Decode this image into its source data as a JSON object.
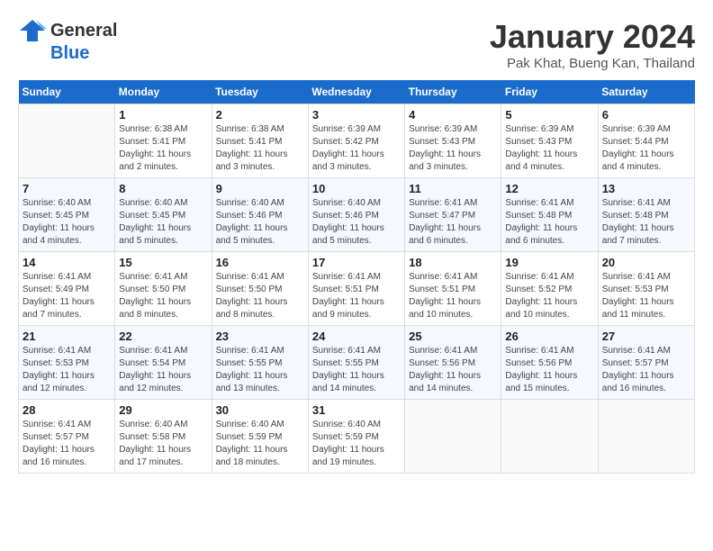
{
  "header": {
    "logo_line1": "General",
    "logo_line2": "Blue",
    "month_title": "January 2024",
    "subtitle": "Pak Khat, Bueng Kan, Thailand"
  },
  "days_of_week": [
    "Sunday",
    "Monday",
    "Tuesday",
    "Wednesday",
    "Thursday",
    "Friday",
    "Saturday"
  ],
  "weeks": [
    [
      {
        "day": "",
        "info": ""
      },
      {
        "day": "1",
        "info": "Sunrise: 6:38 AM\nSunset: 5:41 PM\nDaylight: 11 hours\nand 2 minutes."
      },
      {
        "day": "2",
        "info": "Sunrise: 6:38 AM\nSunset: 5:41 PM\nDaylight: 11 hours\nand 3 minutes."
      },
      {
        "day": "3",
        "info": "Sunrise: 6:39 AM\nSunset: 5:42 PM\nDaylight: 11 hours\nand 3 minutes."
      },
      {
        "day": "4",
        "info": "Sunrise: 6:39 AM\nSunset: 5:43 PM\nDaylight: 11 hours\nand 3 minutes."
      },
      {
        "day": "5",
        "info": "Sunrise: 6:39 AM\nSunset: 5:43 PM\nDaylight: 11 hours\nand 4 minutes."
      },
      {
        "day": "6",
        "info": "Sunrise: 6:39 AM\nSunset: 5:44 PM\nDaylight: 11 hours\nand 4 minutes."
      }
    ],
    [
      {
        "day": "7",
        "info": "Sunrise: 6:40 AM\nSunset: 5:45 PM\nDaylight: 11 hours\nand 4 minutes."
      },
      {
        "day": "8",
        "info": "Sunrise: 6:40 AM\nSunset: 5:45 PM\nDaylight: 11 hours\nand 5 minutes."
      },
      {
        "day": "9",
        "info": "Sunrise: 6:40 AM\nSunset: 5:46 PM\nDaylight: 11 hours\nand 5 minutes."
      },
      {
        "day": "10",
        "info": "Sunrise: 6:40 AM\nSunset: 5:46 PM\nDaylight: 11 hours\nand 5 minutes."
      },
      {
        "day": "11",
        "info": "Sunrise: 6:41 AM\nSunset: 5:47 PM\nDaylight: 11 hours\nand 6 minutes."
      },
      {
        "day": "12",
        "info": "Sunrise: 6:41 AM\nSunset: 5:48 PM\nDaylight: 11 hours\nand 6 minutes."
      },
      {
        "day": "13",
        "info": "Sunrise: 6:41 AM\nSunset: 5:48 PM\nDaylight: 11 hours\nand 7 minutes."
      }
    ],
    [
      {
        "day": "14",
        "info": "Sunrise: 6:41 AM\nSunset: 5:49 PM\nDaylight: 11 hours\nand 7 minutes."
      },
      {
        "day": "15",
        "info": "Sunrise: 6:41 AM\nSunset: 5:50 PM\nDaylight: 11 hours\nand 8 minutes."
      },
      {
        "day": "16",
        "info": "Sunrise: 6:41 AM\nSunset: 5:50 PM\nDaylight: 11 hours\nand 8 minutes."
      },
      {
        "day": "17",
        "info": "Sunrise: 6:41 AM\nSunset: 5:51 PM\nDaylight: 11 hours\nand 9 minutes."
      },
      {
        "day": "18",
        "info": "Sunrise: 6:41 AM\nSunset: 5:51 PM\nDaylight: 11 hours\nand 10 minutes."
      },
      {
        "day": "19",
        "info": "Sunrise: 6:41 AM\nSunset: 5:52 PM\nDaylight: 11 hours\nand 10 minutes."
      },
      {
        "day": "20",
        "info": "Sunrise: 6:41 AM\nSunset: 5:53 PM\nDaylight: 11 hours\nand 11 minutes."
      }
    ],
    [
      {
        "day": "21",
        "info": "Sunrise: 6:41 AM\nSunset: 5:53 PM\nDaylight: 11 hours\nand 12 minutes."
      },
      {
        "day": "22",
        "info": "Sunrise: 6:41 AM\nSunset: 5:54 PM\nDaylight: 11 hours\nand 12 minutes."
      },
      {
        "day": "23",
        "info": "Sunrise: 6:41 AM\nSunset: 5:55 PM\nDaylight: 11 hours\nand 13 minutes."
      },
      {
        "day": "24",
        "info": "Sunrise: 6:41 AM\nSunset: 5:55 PM\nDaylight: 11 hours\nand 14 minutes."
      },
      {
        "day": "25",
        "info": "Sunrise: 6:41 AM\nSunset: 5:56 PM\nDaylight: 11 hours\nand 14 minutes."
      },
      {
        "day": "26",
        "info": "Sunrise: 6:41 AM\nSunset: 5:56 PM\nDaylight: 11 hours\nand 15 minutes."
      },
      {
        "day": "27",
        "info": "Sunrise: 6:41 AM\nSunset: 5:57 PM\nDaylight: 11 hours\nand 16 minutes."
      }
    ],
    [
      {
        "day": "28",
        "info": "Sunrise: 6:41 AM\nSunset: 5:57 PM\nDaylight: 11 hours\nand 16 minutes."
      },
      {
        "day": "29",
        "info": "Sunrise: 6:40 AM\nSunset: 5:58 PM\nDaylight: 11 hours\nand 17 minutes."
      },
      {
        "day": "30",
        "info": "Sunrise: 6:40 AM\nSunset: 5:59 PM\nDaylight: 11 hours\nand 18 minutes."
      },
      {
        "day": "31",
        "info": "Sunrise: 6:40 AM\nSunset: 5:59 PM\nDaylight: 11 hours\nand 19 minutes."
      },
      {
        "day": "",
        "info": ""
      },
      {
        "day": "",
        "info": ""
      },
      {
        "day": "",
        "info": ""
      }
    ]
  ]
}
